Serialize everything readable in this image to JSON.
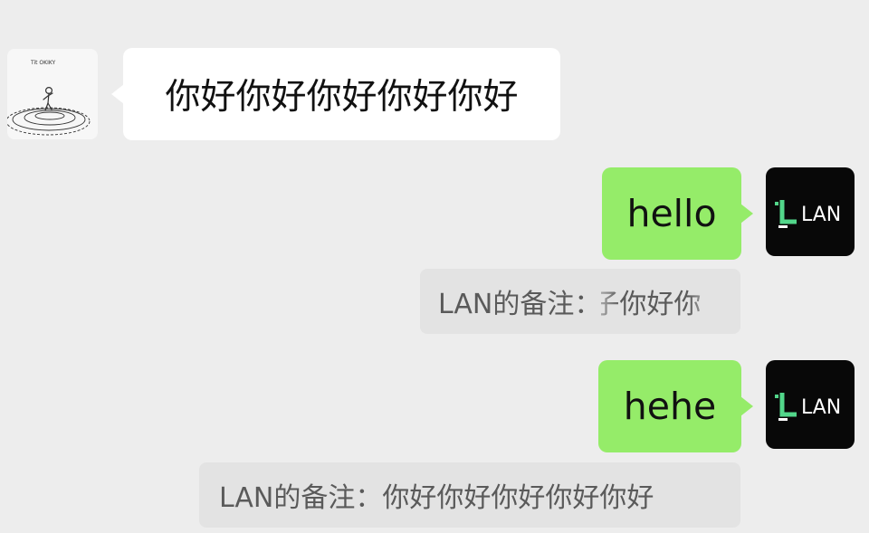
{
  "messages": [
    {
      "side": "left",
      "avatar": {
        "icon": "doodle-pond-avatar-icon",
        "caption": "Tit OKIKY"
      },
      "text": "你好你好你好你好你好"
    },
    {
      "side": "right",
      "avatar": {
        "icon": "lan-logo-icon",
        "text": "LAN"
      },
      "text": "hello",
      "quote": {
        "prefix": "LAN的备注：",
        "content": "子你好你"
      }
    },
    {
      "side": "right",
      "avatar": {
        "icon": "lan-logo-icon",
        "text": "LAN"
      },
      "text": "hehe",
      "quote": {
        "prefix": "LAN的备注：",
        "content": "你好你好你好你好你好"
      }
    }
  ],
  "colors": {
    "background": "#ededed",
    "bubble_self": "#95ec69",
    "bubble_other": "#ffffff",
    "quote_background": "#e3e3e3",
    "logo_accent": "#52d68a"
  }
}
